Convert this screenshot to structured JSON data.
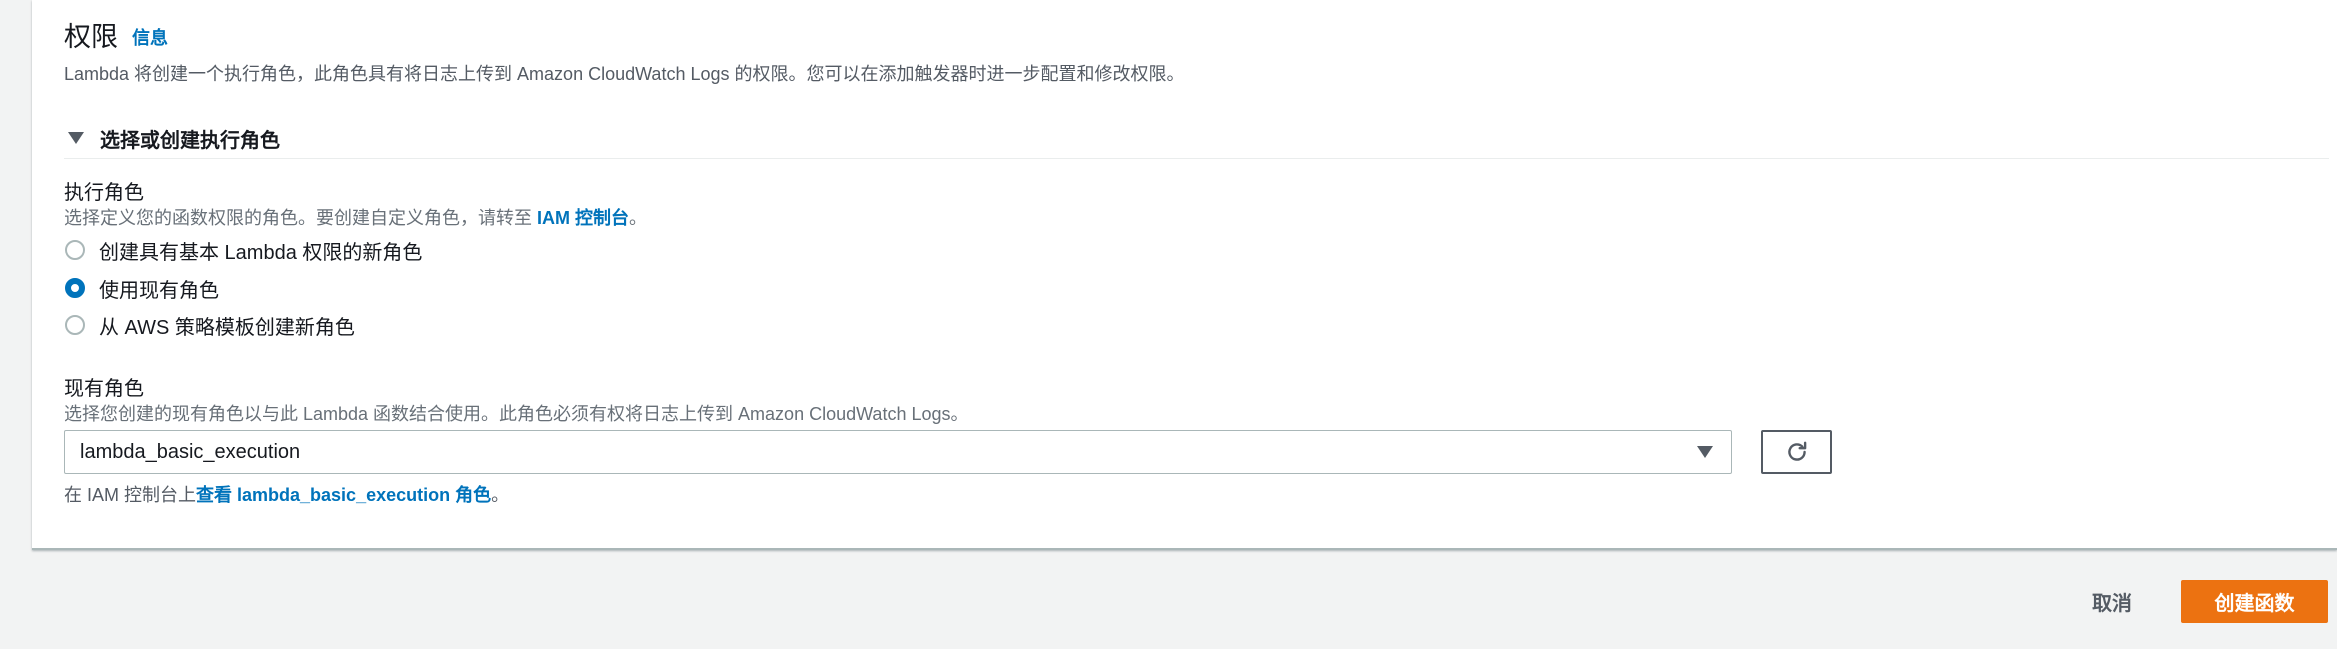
{
  "permissions": {
    "title": "权限",
    "info_link": "信息",
    "description": "Lambda 将创建一个执行角色，此角色具有将日志上传到 Amazon CloudWatch Logs 的权限。您可以在添加触发器时进一步配置和修改权限。"
  },
  "role_section": {
    "expander_label": "选择或创建执行角色",
    "execution_role": {
      "label": "执行角色",
      "description_prefix": "选择定义您的函数权限的角色。要创建自定义角色，请转至 ",
      "description_link": "IAM 控制台",
      "description_suffix": "。",
      "options": [
        {
          "label": "创建具有基本 Lambda 权限的新角色",
          "checked": false
        },
        {
          "label": "使用现有角色",
          "checked": true
        },
        {
          "label": "从 AWS 策略模板创建新角色",
          "checked": false
        }
      ]
    },
    "existing_role": {
      "label": "现有角色",
      "description": "选择您创建的现有角色以与此 Lambda 函数结合使用。此角色必须有权将日志上传到 Amazon CloudWatch Logs。",
      "selected_value": "lambda_basic_execution",
      "view_prefix": "在 IAM 控制台上",
      "view_link": "查看 lambda_basic_execution 角色",
      "view_suffix": "。"
    }
  },
  "footer": {
    "cancel_label": "取消",
    "create_label": "创建函数"
  },
  "colors": {
    "accent": "#0073bb",
    "primary_button": "#ec7211",
    "background": "#f2f3f3"
  },
  "icons": {
    "expander": "caret-down-icon",
    "select": "chevron-down-icon",
    "refresh": "refresh-icon"
  }
}
